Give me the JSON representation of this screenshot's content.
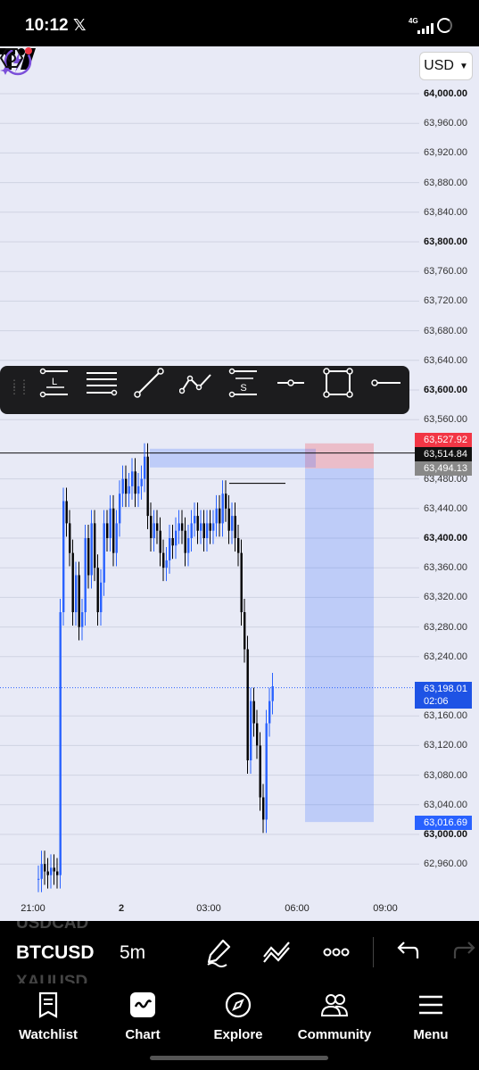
{
  "status_bar": {
    "time": "10:12",
    "network": "4G"
  },
  "chart": {
    "currency": "USD",
    "price_axis": [
      "64,000.00",
      "63,960.00",
      "63,920.00",
      "63,880.00",
      "63,840.00",
      "63,800.00",
      "63,760.00",
      "63,720.00",
      "63,680.00",
      "63,640.00",
      "63,600.00",
      "63,560.00",
      "63,480.00",
      "63,440.00",
      "63,400.00",
      "63,360.00",
      "63,320.00",
      "63,280.00",
      "63,240.00",
      "63,160.00",
      "63,120.00",
      "63,080.00",
      "63,040.00",
      "63,000.00",
      "62,960.00"
    ],
    "bold_prices": [
      "64,000.00",
      "63,800.00",
      "63,600.00",
      "63,400.00",
      "63,000.00"
    ],
    "time_axis": [
      "21:00",
      "2",
      "03:00",
      "06:00",
      "09:00"
    ],
    "badges": {
      "stop_price": "63,527.92",
      "crosshair_price": "63,514.84",
      "entry_price": "63,494.13",
      "current_price": "63,198.01",
      "countdown": "02:06",
      "target_price": "63,016.69"
    },
    "colors": {
      "background": "#e8eaf6",
      "up_candle": "#2962ff",
      "down_candle": "#000000",
      "stop_zone": "#f23645",
      "target_zone": "#2962ff"
    }
  },
  "drawing_toolbar": {
    "tools": [
      "long-position-icon",
      "horizontal-lines-icon",
      "trend-line-icon",
      "path-icon",
      "short-position-icon",
      "horizontal-ray-icon",
      "rectangle-icon",
      "horizontal-line-icon"
    ],
    "long_label": "L",
    "short_label": "S"
  },
  "symbol_bar": {
    "prev_symbol": "USDCAD",
    "current_symbol": "BTCUSD",
    "next_symbol": "XAUUSD",
    "interval": "5m"
  },
  "bottom_nav": {
    "items": [
      {
        "label": "Watchlist",
        "icon": "watchlist-icon"
      },
      {
        "label": "Chart",
        "icon": "chart-icon"
      },
      {
        "label": "Explore",
        "icon": "compass-icon"
      },
      {
        "label": "Community",
        "icon": "community-icon"
      },
      {
        "label": "Menu",
        "icon": "menu-icon"
      }
    ]
  },
  "chart_data": {
    "type": "candlestick",
    "title": "",
    "xlabel": "",
    "ylabel": "",
    "ylim": [
      62940,
      64010
    ],
    "y_ticks": [
      64000,
      63960,
      63920,
      63880,
      63840,
      63800,
      63760,
      63720,
      63680,
      63640,
      63600,
      63560,
      63480,
      63440,
      63400,
      63360,
      63320,
      63280,
      63240,
      63160,
      63120,
      63080,
      63040,
      63000,
      62960
    ],
    "x_ticks": [
      "21:00",
      "2",
      "03:00",
      "06:00",
      "09:00"
    ],
    "grid": true,
    "last_price": 63198.01,
    "position": {
      "type": "short",
      "entry": 63494.13,
      "stop": 63527.92,
      "target": 63016.69
    },
    "crosshair_price": 63514.84,
    "candles_close": [
      62940,
      62960,
      62950,
      62945,
      62955,
      62950,
      62945,
      63300,
      63450,
      63420,
      63380,
      63300,
      63350,
      63280,
      63300,
      63400,
      63350,
      63420,
      63360,
      63300,
      63340,
      63420,
      63400,
      63440,
      63380,
      63420,
      63460,
      63480,
      63460,
      63470,
      63490,
      63460,
      63470,
      63480,
      63510,
      63430,
      63400,
      63420,
      63410,
      63380,
      63360,
      63370,
      63400,
      63390,
      63410,
      63420,
      63410,
      63380,
      63400,
      63420,
      63430,
      63410,
      63420,
      63400,
      63420,
      63410,
      63420,
      63440,
      63420,
      63460,
      63440,
      63410,
      63430,
      63400,
      63380,
      63300,
      63250,
      63100,
      63180,
      63150,
      63120,
      63050,
      63020,
      63150,
      63180,
      63200
    ]
  }
}
